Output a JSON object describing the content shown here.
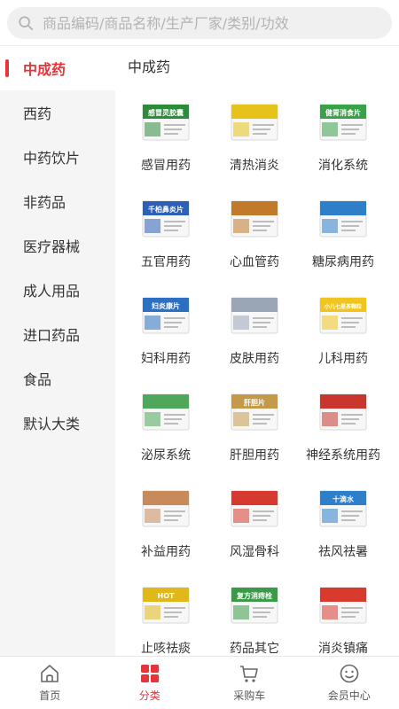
{
  "search": {
    "placeholder": "商品编码/商品名称/生产厂家/类别/功效"
  },
  "sidebar": {
    "items": [
      {
        "label": "中成药",
        "active": true
      },
      {
        "label": "西药"
      },
      {
        "label": "中药饮片"
      },
      {
        "label": "非药品"
      },
      {
        "label": "医疗器械"
      },
      {
        "label": "成人用品"
      },
      {
        "label": "进口药品"
      },
      {
        "label": "食品"
      },
      {
        "label": "默认大类"
      }
    ]
  },
  "main": {
    "title": "中成药",
    "products": [
      {
        "label": "感冒用药",
        "pkg": "感冒灵胶囊",
        "color": "#2e8b3c"
      },
      {
        "label": "清热消炎",
        "pkg": "",
        "color": "#e6c21a"
      },
      {
        "label": "消化系统",
        "pkg": "健胃消食片",
        "color": "#3aa04a"
      },
      {
        "label": "五官用药",
        "pkg": "千柏鼻炎片",
        "color": "#2b5fb8"
      },
      {
        "label": "心血管药",
        "pkg": "",
        "color": "#c07a2a"
      },
      {
        "label": "糖尿病用药",
        "pkg": "",
        "color": "#2f7fc8"
      },
      {
        "label": "妇科用药",
        "pkg": "妇炎康片",
        "color": "#2d6fc2"
      },
      {
        "label": "皮肤用药",
        "pkg": "",
        "color": "#9aa6b6"
      },
      {
        "label": "儿科用药",
        "pkg": "小儿七星茶颗粒",
        "color": "#f0c51e"
      },
      {
        "label": "泌尿系统",
        "pkg": "",
        "color": "#4fa85a"
      },
      {
        "label": "肝胆用药",
        "pkg": "肝胆片",
        "color": "#c49a4a"
      },
      {
        "label": "神经系统用药",
        "pkg": "",
        "color": "#c8362e"
      },
      {
        "label": "补益用药",
        "pkg": "",
        "color": "#c88a5a"
      },
      {
        "label": "风湿骨科",
        "pkg": "",
        "color": "#d63a2e"
      },
      {
        "label": "祛风祛暑",
        "pkg": "十滴水",
        "color": "#2e7fc9"
      },
      {
        "label": "止咳祛痰",
        "pkg": "HOT",
        "color": "#e0b818"
      },
      {
        "label": "药品其它",
        "pkg": "复方消痔栓",
        "color": "#3a9a48"
      },
      {
        "label": "消炎镇痛",
        "pkg": "",
        "color": "#d83a2e"
      }
    ]
  },
  "tabbar": {
    "items": [
      {
        "label": "首页",
        "icon": "home-icon"
      },
      {
        "label": "分类",
        "icon": "grid-icon",
        "active": true
      },
      {
        "label": "采购车",
        "icon": "cart-icon"
      },
      {
        "label": "会员中心",
        "icon": "face-icon"
      }
    ]
  },
  "colors": {
    "accent": "#e8333a",
    "sidebar_bg": "#f5f5f5",
    "search_bg": "#f0f0f0"
  }
}
